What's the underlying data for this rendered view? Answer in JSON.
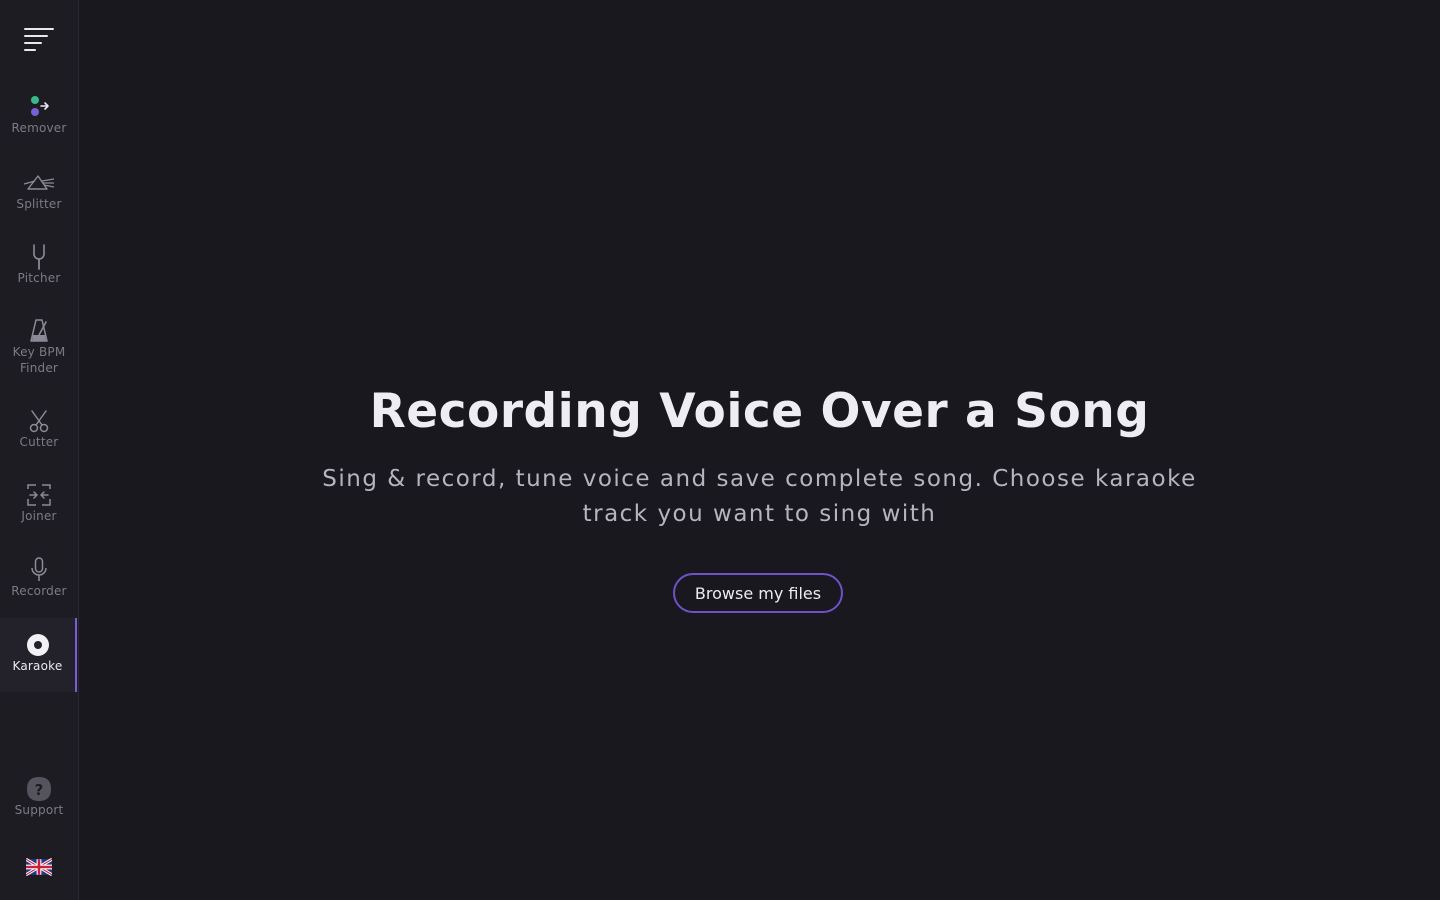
{
  "sidebar": {
    "menu_icon": "hamburger-menu-icon",
    "items": [
      {
        "label": "Remover",
        "icon": "vocal-remover-icon"
      },
      {
        "label": "Splitter",
        "icon": "prism-splitter-icon"
      },
      {
        "label": "Pitcher",
        "icon": "tuning-fork-icon"
      },
      {
        "label": "Key BPM Finder",
        "icon": "metronome-icon"
      },
      {
        "label": "Cutter",
        "icon": "scissors-icon"
      },
      {
        "label": "Joiner",
        "icon": "join-arrows-icon"
      },
      {
        "label": "Recorder",
        "icon": "microphone-icon"
      },
      {
        "label": "Karaoke",
        "icon": "vinyl-record-icon",
        "active": true
      }
    ],
    "support": {
      "label": "Support",
      "icon": "question-icon"
    },
    "language": {
      "icon": "uk-flag-icon"
    }
  },
  "main": {
    "title": "Recording Voice Over a Song",
    "subtitle": "Sing & record, tune voice and save complete song. Choose karaoke track you want to sing with",
    "browse_button": "Browse my files"
  },
  "colors": {
    "background": "#19181f",
    "sidebar": "#1d1c23",
    "accent": "#6f51c9",
    "dot_green": "#3ab88c",
    "dot_purple": "#7a5ed8"
  }
}
